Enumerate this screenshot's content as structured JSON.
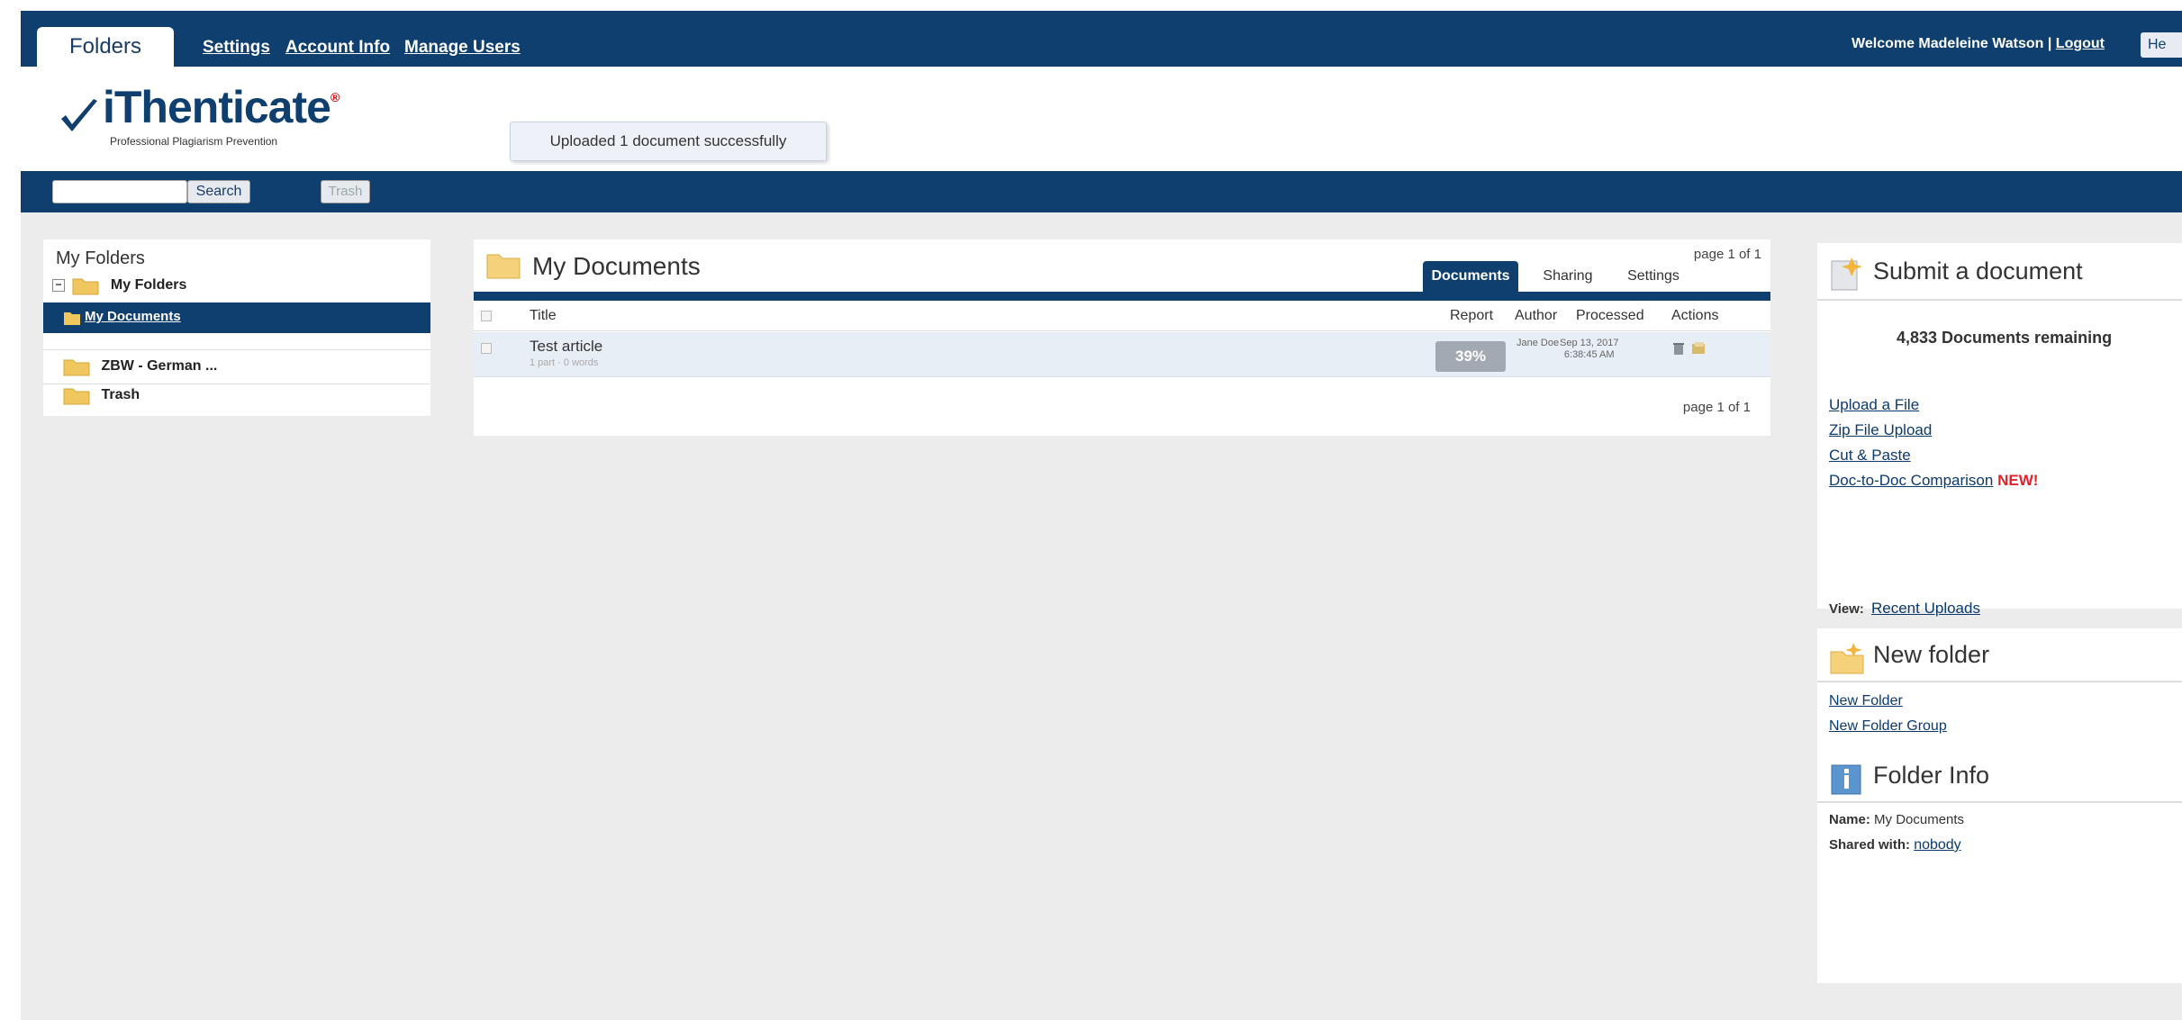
{
  "nav": {
    "active_tab": "Folders",
    "links": [
      "Settings",
      "Account Info",
      "Manage Users"
    ],
    "welcome_text": "Welcome Madeleine Watson |",
    "logout": "Logout",
    "help": "He"
  },
  "brand": {
    "name": "iThenticate",
    "reg": "®",
    "tagline": "Professional Plagiarism Prevention"
  },
  "notice": "Uploaded 1 document successfully",
  "toolbar": {
    "search_value": "",
    "search_button": "Search",
    "trash_button": "Trash"
  },
  "sidebar": {
    "title": "My Folders",
    "root": "My Folders",
    "items": [
      "My Documents",
      "ZBW - German ...",
      "Trash"
    ]
  },
  "documents": {
    "folder_title": "My Documents",
    "page_top": "page 1 of 1",
    "page_bottom": "page 1 of 1",
    "tabs": [
      "Documents",
      "Sharing",
      "Settings"
    ],
    "columns": [
      "Title",
      "Report",
      "Author",
      "Processed",
      "Actions"
    ],
    "rows": [
      {
        "title": "Test article",
        "subtitle": "1 part · 0 words",
        "report": "39%",
        "author": "Jane Doe",
        "processed_date": "Sep 13, 2017",
        "processed_time": "6:38:45 AM"
      }
    ]
  },
  "submit": {
    "title": "Submit a document",
    "remaining": "4,833 Documents remaining",
    "links": [
      "Upload a File",
      "Zip File Upload",
      "Cut & Paste",
      "Doc-to-Doc Comparison"
    ],
    "new_tag": "NEW!",
    "view_label": "View:",
    "view_link": "Recent Uploads"
  },
  "new_folder": {
    "title": "New folder",
    "links": [
      "New Folder",
      "New Folder Group"
    ]
  },
  "folder_info": {
    "title": "Folder Info",
    "name_label": "Name:",
    "name_value": "My Documents",
    "shared_label": "Shared with:",
    "shared_value": "nobody"
  },
  "colors": {
    "brand_blue": "#0e3f6e",
    "content_bg": "#ececec",
    "report_badge": "#a3a9b2",
    "new_tag": "#e0232b"
  }
}
